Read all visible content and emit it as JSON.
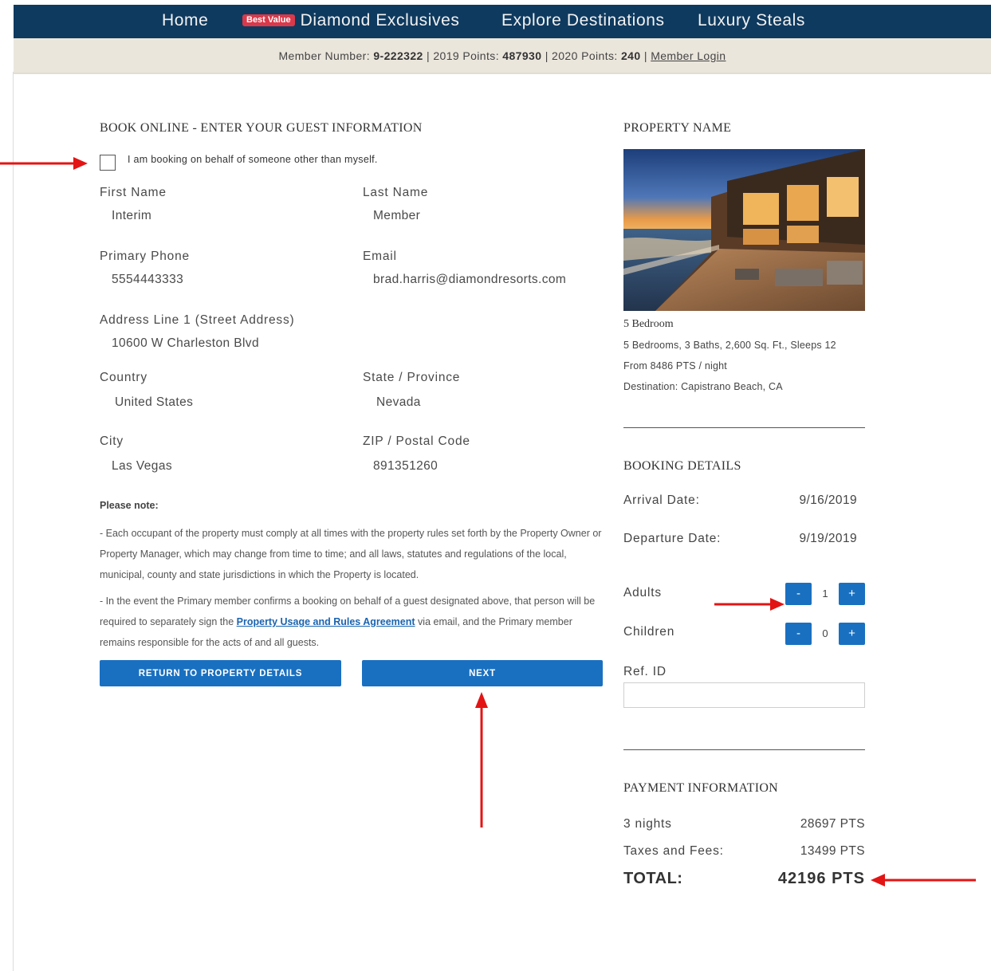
{
  "nav": {
    "home": "Home",
    "badge": "Best Value",
    "diamond": "Diamond Exclusives",
    "explore": "Explore Destinations",
    "luxury": "Luxury Steals"
  },
  "member_bar": {
    "number_label": "Member Number:",
    "number": "9-222322",
    "points2019_label": "2019 Points:",
    "points2019": "487930",
    "points2020_label": "2020 Points:",
    "points2020": "240",
    "sep": "|",
    "login": "Member Login"
  },
  "form": {
    "heading": "BOOK ONLINE - ENTER YOUR GUEST INFORMATION",
    "behalf_label": "I am booking on behalf of someone other than myself.",
    "first_name_label": "First Name",
    "first_name": "Interim",
    "last_name_label": "Last Name",
    "last_name": "Member",
    "phone_label": "Primary Phone",
    "phone": "5554443333",
    "email_label": "Email",
    "email": "brad.harris@diamondresorts.com",
    "address_label": "Address Line 1 (Street Address)",
    "address": "10600 W Charleston Blvd",
    "country_label": "Country",
    "country": "United States",
    "state_label": "State / Province",
    "state": "Nevada",
    "city_label": "City",
    "city": "Las Vegas",
    "zip_label": "ZIP / Postal Code",
    "zip": "891351260",
    "note_heading": "Please note:",
    "note1": "- Each occupant of the property must comply at all times with the property rules set forth by the Property Owner or Property Manager, which may change from time to time; and all laws, statutes and regulations of the local, municipal, county and state jurisdictions in which the Property is located.",
    "note2_a": "- In the event the Primary member confirms a booking on behalf of a guest designated above, that person will be required to separately sign the ",
    "note2_link": "Property Usage and Rules Agreement",
    "note2_b": " via email, and the Primary member remains responsible for the acts of and all guests.",
    "return_button": "RETURN TO PROPERTY DETAILS",
    "next_button": "NEXT"
  },
  "property": {
    "heading": "PROPERTY NAME",
    "name": "5 Bedroom",
    "specs": "5 Bedrooms, 3 Baths, 2,600 Sq. Ft., Sleeps 12",
    "price": "From 8486 PTS / night",
    "destination": "Destination: Capistrano Beach, CA"
  },
  "booking": {
    "heading": "BOOKING DETAILS",
    "arrival_label": "Arrival Date:",
    "arrival": "9/16/2019",
    "departure_label": "Departure Date:",
    "departure": "9/19/2019",
    "adults_label": "Adults",
    "adults": "1",
    "children_label": "Children",
    "children": "0",
    "minus": "-",
    "plus": "+",
    "ref_label": "Ref. ID",
    "ref_value": ""
  },
  "payment": {
    "heading": "PAYMENT INFORMATION",
    "nights_label": "3 nights",
    "nights_value": "28697 PTS",
    "taxes_label": "Taxes and Fees:",
    "taxes_value": "13499 PTS",
    "total_label": "TOTAL:",
    "total_value": "42196 PTS"
  },
  "colors": {
    "nav_bg": "#0f3a5f",
    "member_bar_bg": "#ebe6dc",
    "button_blue": "#1a70c0",
    "badge_red": "#d9394a",
    "annotation_red": "#e31414"
  }
}
